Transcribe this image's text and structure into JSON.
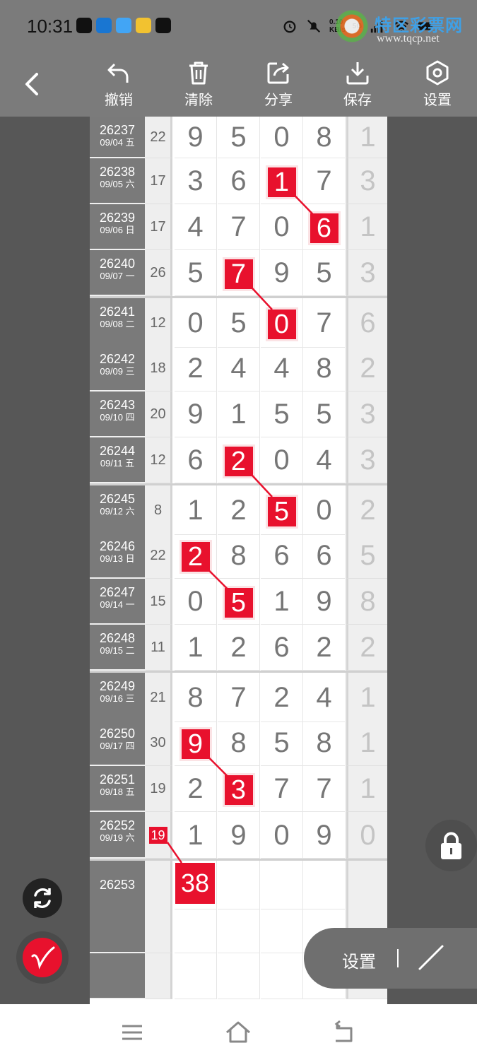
{
  "status": {
    "time": "10:31",
    "net_speed_value": "0.10",
    "net_speed_unit": "KB/s",
    "network_type": "5G",
    "icons": [
      "tiktok-icon",
      "blue-app-icon",
      "cloud-app-icon",
      "yellow-app-icon",
      "tiktok-icon",
      "alarm-icon",
      "mute-icon",
      "signal-icon",
      "wifi-icon",
      "battery-icon"
    ]
  },
  "watermark": {
    "title": "特区彩票网",
    "url": "www.tqcp.net"
  },
  "toolbar": {
    "undo": "撤销",
    "clear": "清除",
    "share": "分享",
    "save": "保存",
    "settings": "设置"
  },
  "rows": [
    {
      "period": "26237",
      "date": "09/04 五",
      "sum": "22",
      "digits": [
        "9",
        "5",
        "0",
        "8"
      ],
      "extra": "1"
    },
    {
      "period": "26238",
      "date": "09/05 六",
      "sum": "17",
      "digits": [
        "3",
        "6",
        "1",
        "7"
      ],
      "extra": "3"
    },
    {
      "period": "26239",
      "date": "09/06 日",
      "sum": "17",
      "digits": [
        "4",
        "7",
        "0",
        "6"
      ],
      "extra": "1"
    },
    {
      "period": "26240",
      "date": "09/07 一",
      "sum": "26",
      "digits": [
        "5",
        "7",
        "9",
        "5"
      ],
      "extra": "3"
    },
    {
      "period": "26241",
      "date": "09/08 二",
      "sum": "12",
      "digits": [
        "0",
        "5",
        "0",
        "7"
      ],
      "extra": "6"
    },
    {
      "period": "26242",
      "date": "09/09 三",
      "sum": "18",
      "digits": [
        "2",
        "4",
        "4",
        "8"
      ],
      "extra": "2"
    },
    {
      "period": "26243",
      "date": "09/10 四",
      "sum": "20",
      "digits": [
        "9",
        "1",
        "5",
        "5"
      ],
      "extra": "3"
    },
    {
      "period": "26244",
      "date": "09/11 五",
      "sum": "12",
      "digits": [
        "6",
        "2",
        "0",
        "4"
      ],
      "extra": "3"
    },
    {
      "period": "26245",
      "date": "09/12 六",
      "sum": "8",
      "digits": [
        "1",
        "2",
        "5",
        "0"
      ],
      "extra": "2"
    },
    {
      "period": "26246",
      "date": "09/13 日",
      "sum": "22",
      "digits": [
        "2",
        "8",
        "6",
        "6"
      ],
      "extra": "5"
    },
    {
      "period": "26247",
      "date": "09/14 一",
      "sum": "15",
      "digits": [
        "0",
        "5",
        "1",
        "9"
      ],
      "extra": "8"
    },
    {
      "period": "26248",
      "date": "09/15 二",
      "sum": "11",
      "digits": [
        "1",
        "2",
        "6",
        "2"
      ],
      "extra": "2"
    },
    {
      "period": "26249",
      "date": "09/16 三",
      "sum": "21",
      "digits": [
        "8",
        "7",
        "2",
        "4"
      ],
      "extra": "1"
    },
    {
      "period": "26250",
      "date": "09/17 四",
      "sum": "30",
      "digits": [
        "9",
        "8",
        "5",
        "8"
      ],
      "extra": "1"
    },
    {
      "period": "26251",
      "date": "09/18 五",
      "sum": "19",
      "digits": [
        "2",
        "3",
        "7",
        "7"
      ],
      "extra": "1"
    },
    {
      "period": "26252",
      "date": "09/19 六",
      "sum": "19",
      "digits": [
        "1",
        "9",
        "0",
        "9"
      ],
      "extra": "0"
    },
    {
      "period": "26253",
      "date": "",
      "sum": "",
      "digits": [
        "",
        "",
        "",
        ""
      ],
      "extra": ""
    },
    {
      "period": "",
      "date": "",
      "sum": "",
      "digits": [
        "",
        "",
        "",
        ""
      ],
      "extra": ""
    },
    {
      "period": "",
      "date": "",
      "sum": "",
      "digits": [
        "",
        "",
        "",
        ""
      ],
      "extra": ""
    }
  ],
  "highlights": [
    {
      "row": 1,
      "col": 2
    },
    {
      "row": 2,
      "col": 3
    },
    {
      "row": 3,
      "col": 1
    },
    {
      "row": 4,
      "col": 2
    },
    {
      "row": 7,
      "col": 1
    },
    {
      "row": 8,
      "col": 2
    },
    {
      "row": 9,
      "col": 0
    },
    {
      "row": 10,
      "col": 1
    },
    {
      "row": 13,
      "col": 0
    },
    {
      "row": 14,
      "col": 1
    }
  ],
  "sum_highlight_row": 15,
  "prediction": {
    "row": 16,
    "value": "38"
  },
  "floating": {
    "settings_label": "设置"
  },
  "colors": {
    "highlight": "#e8112d",
    "period_bg": "#7a7a7a",
    "page_bg": "#575757"
  }
}
